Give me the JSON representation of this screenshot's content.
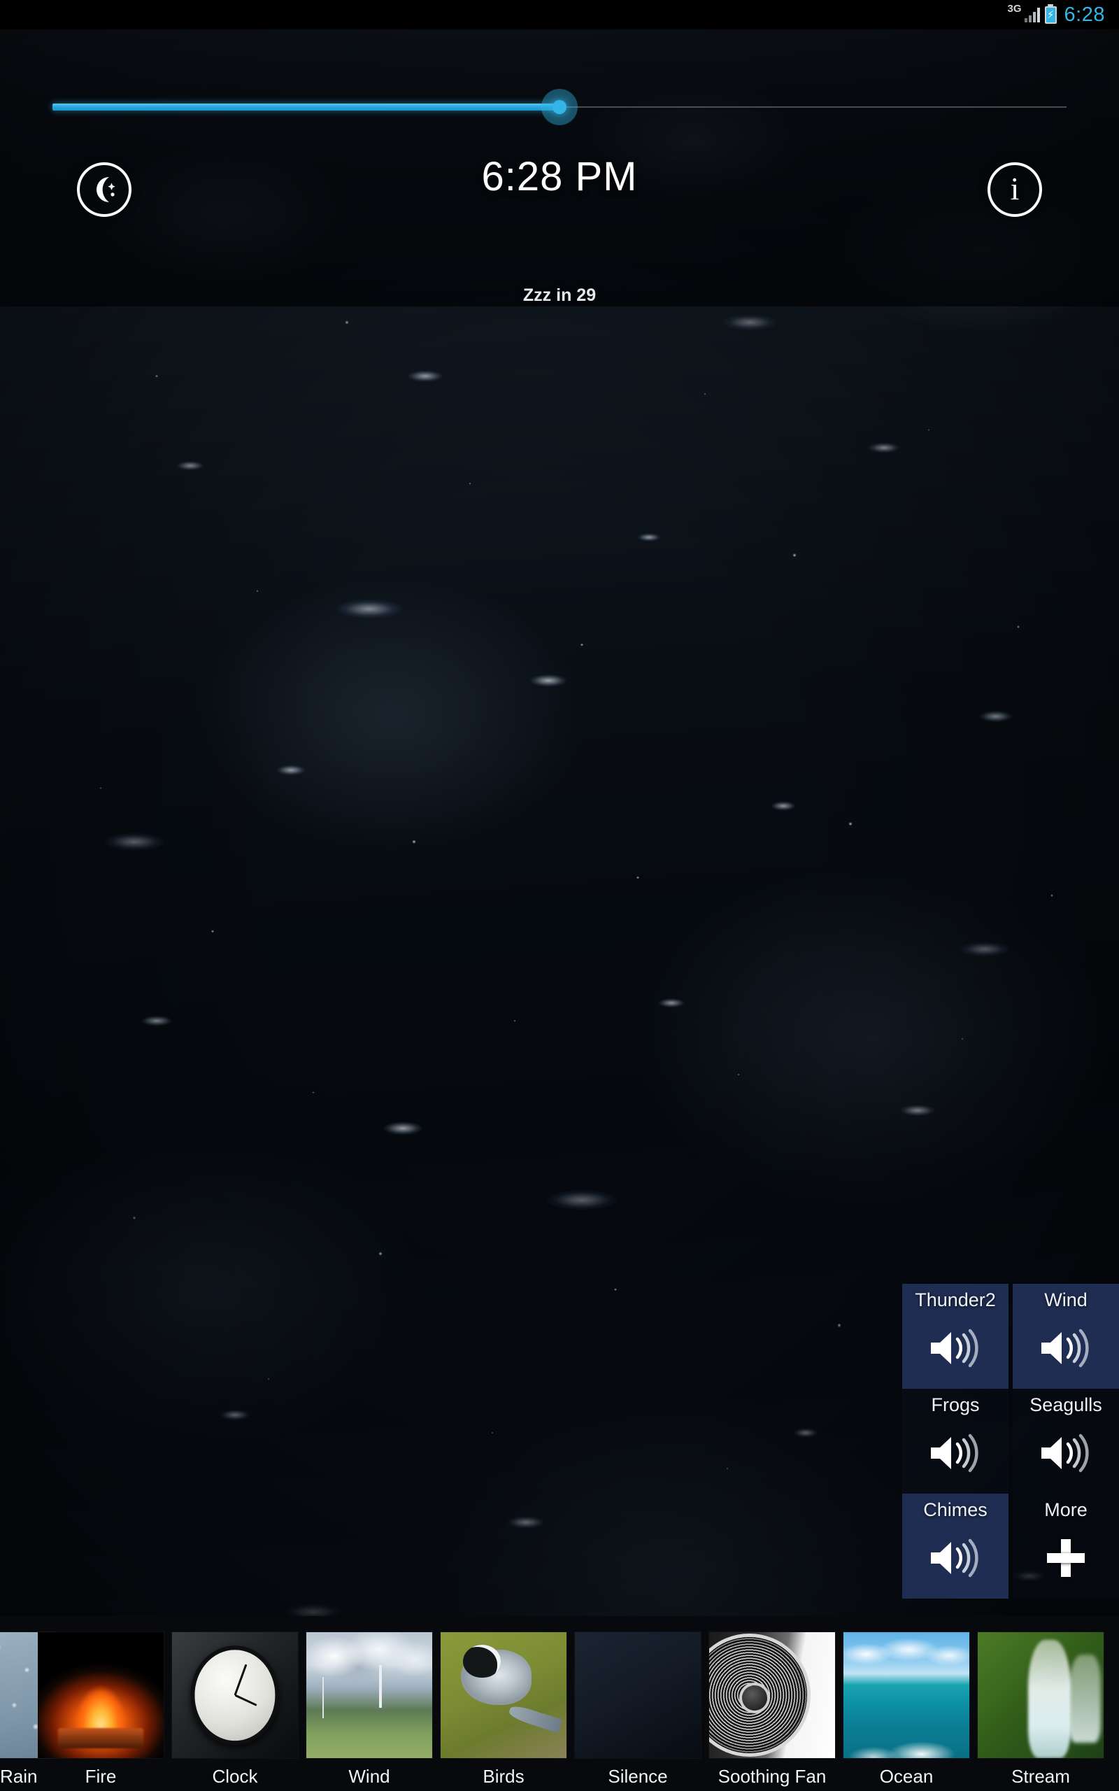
{
  "statusbar": {
    "network_label": "3G",
    "signal_icon": "signal-bars-icon",
    "battery_icon": "battery-charging-icon",
    "charging_glyph": "⚡",
    "time": "6:28"
  },
  "header": {
    "volume_slider": {
      "icon": "volume-slider",
      "value_percent": 50,
      "min": 0,
      "max": 100
    },
    "sleep_button_label": "moon-icon",
    "info_button_label": "i",
    "clock_time": "6:28 PM",
    "timer_text": "Zzz in 29"
  },
  "sound_grid": {
    "tiles": [
      {
        "label": "Thunder2",
        "icon": "volume-on-icon",
        "active": true
      },
      {
        "label": "Wind",
        "icon": "volume-on-icon",
        "active": true
      },
      {
        "label": "Frogs",
        "icon": "volume-on-icon",
        "active": false
      },
      {
        "label": "Seagulls",
        "icon": "volume-on-icon",
        "active": false
      },
      {
        "label": "Chimes",
        "icon": "volume-on-icon",
        "active": true
      },
      {
        "label": "More",
        "icon": "plus-icon",
        "active": false
      }
    ]
  },
  "thumb_strip": {
    "items": [
      {
        "label": "Rain",
        "art": "art-rain"
      },
      {
        "label": "Fire",
        "art": "art-fire"
      },
      {
        "label": "Clock",
        "art": "art-clock"
      },
      {
        "label": "Wind",
        "art": "art-wind"
      },
      {
        "label": "Birds",
        "art": "art-birds"
      },
      {
        "label": "Silence",
        "art": "art-silence"
      },
      {
        "label": "Soothing Fan",
        "art": "art-fan"
      },
      {
        "label": "Ocean",
        "art": "art-ocean"
      },
      {
        "label": "Stream",
        "art": "art-stream"
      }
    ]
  },
  "colors": {
    "accent": "#33b5e5",
    "tile_active": "#213058",
    "status_text": "#33b5e5",
    "strip_background": "#07090c"
  }
}
